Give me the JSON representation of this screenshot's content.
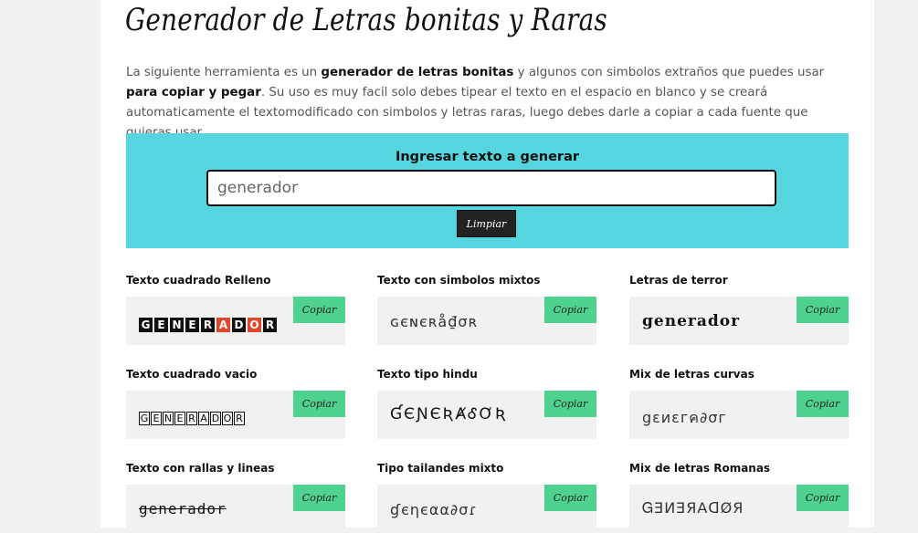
{
  "header": {
    "title": "Generador de Letras bonitas y Raras"
  },
  "intro": {
    "p1": "La siguiente herramienta es un ",
    "b1": "generador de letras bonitas",
    "p2": " y algunos con simbolos extraños que puedes usar ",
    "b2": "para copiar y pegar",
    "p3": ". Su uso es muy facil solo debes tipear el texto en el espacio en blanco y se creará automaticamente el textomodificado con simbolos y letras raras, luego debes darle a copiar a cada fuente que quieras usar."
  },
  "generator": {
    "label": "Ingresar texto a generar",
    "input_value": "generador",
    "clear_label": "Limpiar"
  },
  "copy_label": "Copiar",
  "cards": [
    {
      "title": "Texto cuadrado Relleno",
      "letters": [
        "G",
        "E",
        "N",
        "E",
        "R",
        "A",
        "D",
        "O",
        "R"
      ]
    },
    {
      "title": "Texto con simbolos mixtos",
      "sample": "ɢєɴєʀå₫σʀ"
    },
    {
      "title": "Letras de terror",
      "sample": "generador"
    },
    {
      "title": "Texto cuadrado vacio",
      "letters": [
        "G",
        "E",
        "N",
        "E",
        "R",
        "A",
        "D",
        "O",
        "R"
      ]
    },
    {
      "title": "Texto tipo hindu",
      "sample": "ƓЄƝЄƦȺᎴƠƦ"
    },
    {
      "title": "Mix de letras curvas",
      "sample": "ցεиεгค∂σг"
    },
    {
      "title": "Texto con rallas y lineas",
      "sample": "generador"
    },
    {
      "title": "Tipo tailandes mixto",
      "sample": "ɠєηєαα∂σɾ"
    },
    {
      "title": "Mix de letras Romanas",
      "sample": "ᏀƎИƎЯAᗡØЯ"
    }
  ]
}
